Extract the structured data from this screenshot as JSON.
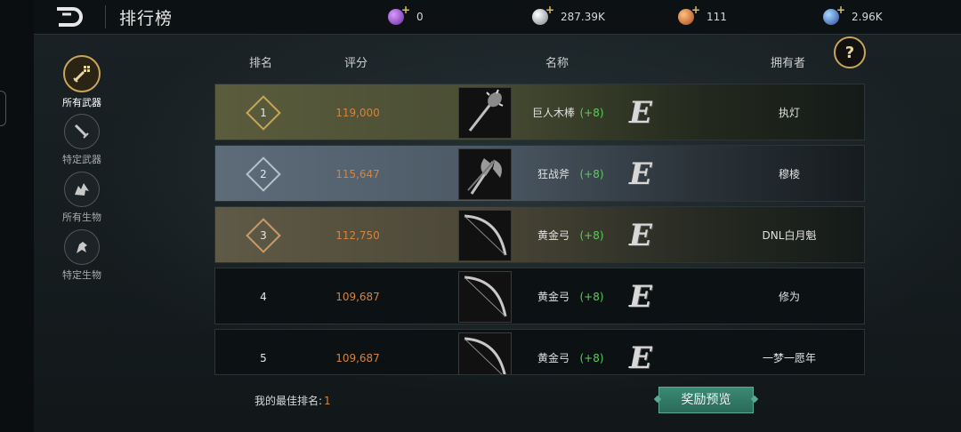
{
  "header": {
    "title": "排行榜"
  },
  "currencies": [
    {
      "icon": "purple-gem-icon",
      "value": "0",
      "color": "#9b4fd0"
    },
    {
      "icon": "silver-coin-icon",
      "value": "287.39K",
      "color": "#c0c6cc"
    },
    {
      "icon": "orange-crystal-icon",
      "value": "111",
      "color": "#e07a3a"
    },
    {
      "icon": "blue-orb-icon",
      "value": "2.96K",
      "color": "#4a8ad8"
    }
  ],
  "sidebar": {
    "items": [
      {
        "label": "所有武器",
        "icon": "sword-grid-icon",
        "active": true
      },
      {
        "label": "特定武器",
        "icon": "sword-icon",
        "active": false
      },
      {
        "label": "所有生物",
        "icon": "creature-group-icon",
        "active": false
      },
      {
        "label": "特定生物",
        "icon": "creature-icon",
        "active": false
      }
    ]
  },
  "table": {
    "headers": {
      "rank": "排名",
      "score": "评分",
      "name": "名称",
      "owner": "拥有者"
    },
    "rows": [
      {
        "rank": "1",
        "score": "119,000",
        "weapon": "巨人木棒",
        "enhance": "(+8)",
        "grade": "E",
        "owner": "执灯",
        "weapon_icon": "club-icon"
      },
      {
        "rank": "2",
        "score": "115,647",
        "weapon": "狂战斧",
        "enhance": "(+8)",
        "grade": "E",
        "owner": "穆棱",
        "weapon_icon": "axe-icon"
      },
      {
        "rank": "3",
        "score": "112,750",
        "weapon": "黄金弓",
        "enhance": "(+8)",
        "grade": "E",
        "owner": "DNL白月魁",
        "weapon_icon": "bow-icon"
      },
      {
        "rank": "4",
        "score": "109,687",
        "weapon": "黄金弓",
        "enhance": "(+8)",
        "grade": "E",
        "owner": "修为",
        "weapon_icon": "bow-icon"
      },
      {
        "rank": "5",
        "score": "109,687",
        "weapon": "黄金弓",
        "enhance": "(+8)",
        "grade": "E",
        "owner": "一梦一愿年",
        "weapon_icon": "bow-icon"
      }
    ]
  },
  "footer": {
    "best_label": "我的最佳排名:",
    "best_value": "1",
    "reward_button": "奖励预览"
  },
  "help_label": "?",
  "colors": {
    "accent_gold": "#c9a55a",
    "score_orange": "#d9823a",
    "enhance_green": "#5ccc5c",
    "button_teal": "#2f7a66"
  }
}
